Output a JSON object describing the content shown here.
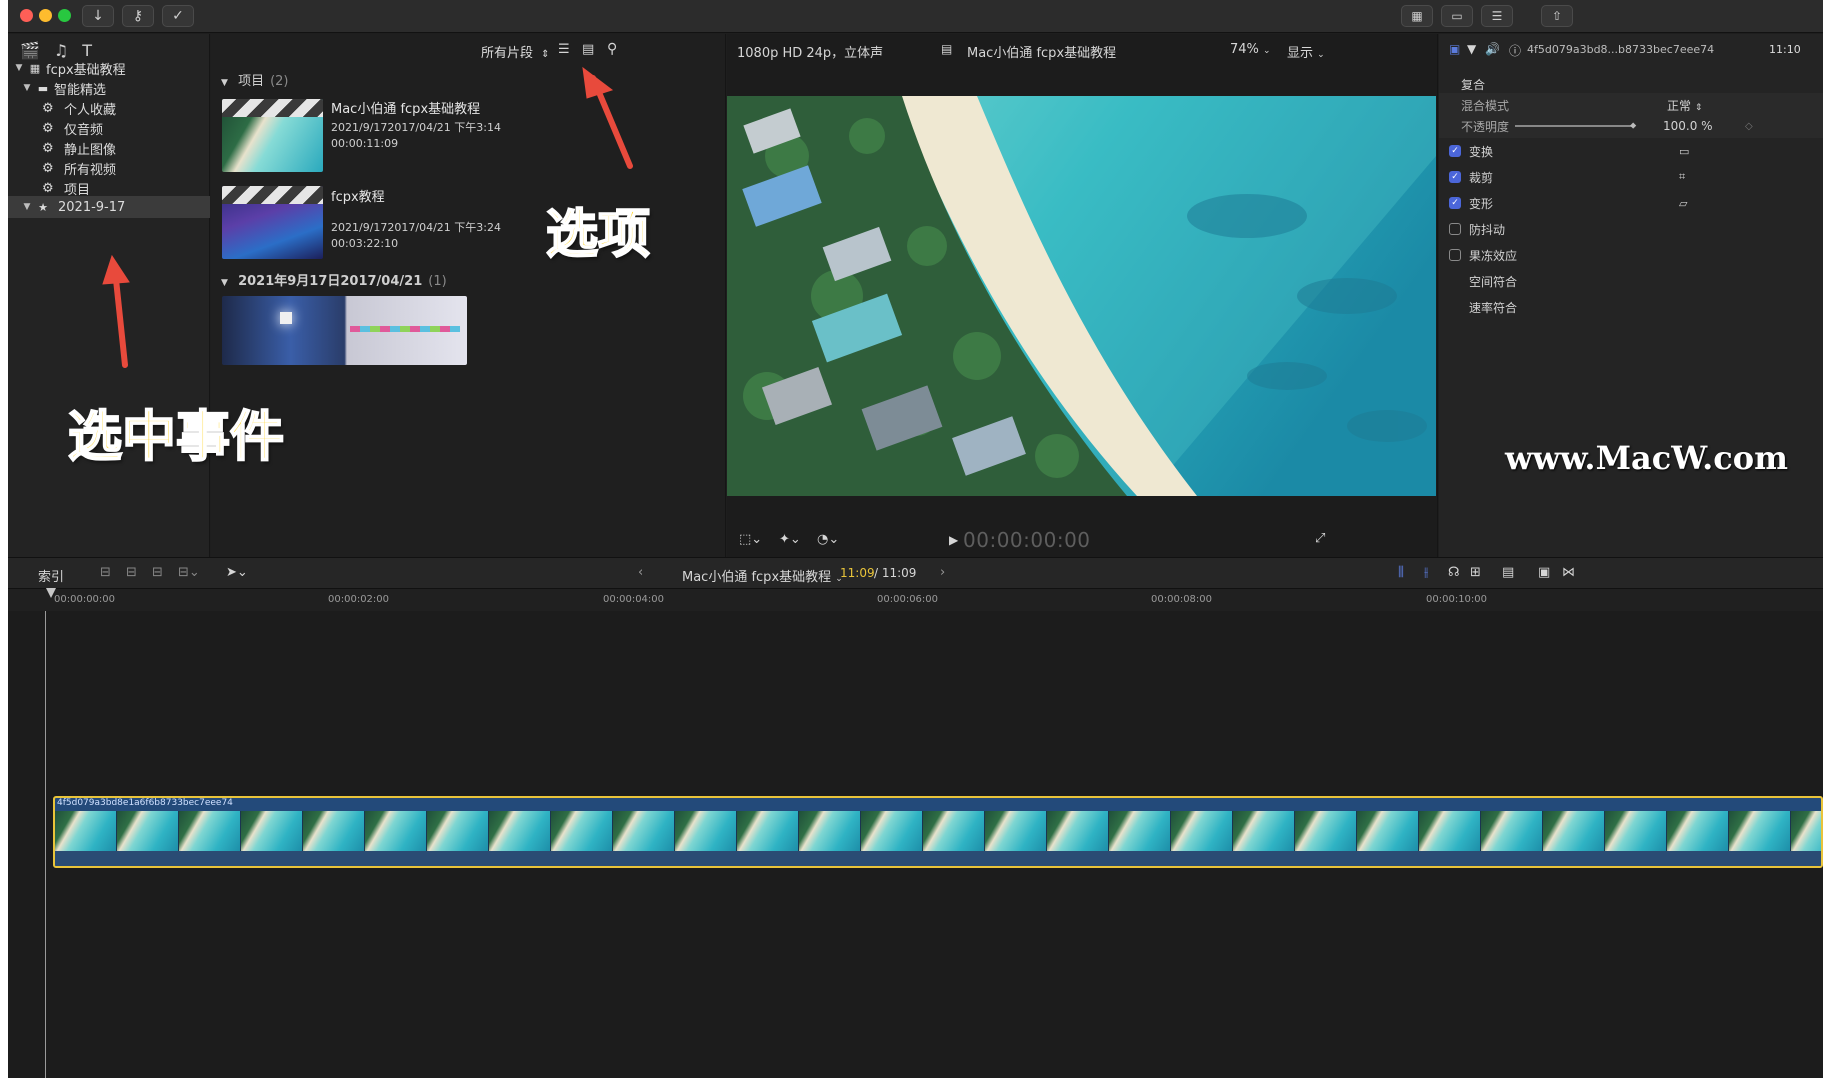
{
  "colors": {
    "accent": "#4b66d9",
    "clip_outline": "#e9c43a",
    "annotation": "#ffd21f",
    "arrow": "#e84a3c",
    "timecode_active": "#e9c43a"
  },
  "sidebar": {
    "library": "fcpx基础教程",
    "smart_folder": "智能精选",
    "items": [
      "个人收藏",
      "仅音频",
      "静止图像",
      "所有视频",
      "项目"
    ],
    "event": "2021-9-17"
  },
  "browser": {
    "filter": "所有片段",
    "projects_section": {
      "title": "项目",
      "count": "(2)"
    },
    "clips": [
      {
        "name": "Mac小伯通 fcpx基础教程",
        "date": "2021/9/172017/04/21 下午3:14",
        "duration": "00:00:11:09"
      },
      {
        "name": "fcpx教程",
        "date": "2021/9/172017/04/21 下午3:24",
        "duration": "00:03:22:10"
      }
    ],
    "date_section": {
      "title": "2021年9月17日2017/04/21",
      "count": "(1)"
    }
  },
  "viewer": {
    "format": "1080p HD 24p，立体声",
    "title": "Mac小伯通 fcpx基础教程",
    "zoom": "74%",
    "display": "显示",
    "timecode": "00:00:00:00"
  },
  "inspector": {
    "clip_id": "4f5d079a3bd8...b8733bec7eee74",
    "duration": "11:10",
    "composite": "复合",
    "blend_mode_label": "混合模式",
    "blend_mode_value": "正常",
    "opacity_label": "不透明度",
    "opacity_value": "100.0 %",
    "opacity_level": 1.0,
    "sections": [
      {
        "label": "变换",
        "checked": true
      },
      {
        "label": "裁剪",
        "checked": true
      },
      {
        "label": "变形",
        "checked": true
      },
      {
        "label": "防抖动",
        "checked": false
      },
      {
        "label": "果冻效应",
        "checked": false
      }
    ],
    "extra": [
      "空间符合",
      "速率符合"
    ]
  },
  "timeline": {
    "index": "索引",
    "project": "Mac小伯通 fcpx基础教程",
    "position": "11:09",
    "total": "/ 11:09",
    "ruler": [
      "00:00:00:00",
      "00:00:02:00",
      "00:00:04:00",
      "00:00:06:00",
      "00:00:08:00",
      "00:00:10:00"
    ],
    "clip_name": "4f5d079a3bd8e1a6f6b8733bec7eee74"
  },
  "annotations": {
    "options": "选项",
    "select_event": "选中事件"
  },
  "watermark": "www.MacW.com"
}
